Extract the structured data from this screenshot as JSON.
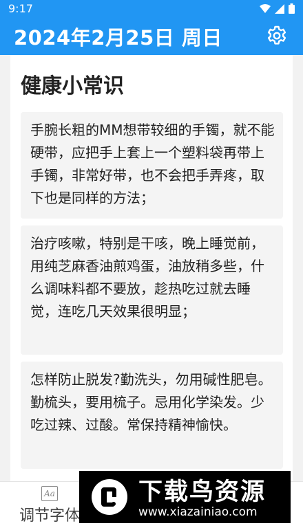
{
  "status_bar": {
    "time": "9:17",
    "icons": [
      "wifi-icon",
      "signal-icon",
      "battery-icon"
    ]
  },
  "app_bar": {
    "title": "2024年2月25日 周日",
    "settings_icon": "gear-icon"
  },
  "content": {
    "section_title": "健康小常识",
    "tips": [
      "手腕长粗的MM想带较细的手镯，就不能硬带，应把手上套上一个塑料袋再带上手镯，非常好带，也不会把手弄疼，取下也是同样的方法；",
      "治疗咳嗽，特别是干咳，晚上睡觉前，用纯芝麻香油煎鸡蛋，油放稍多些，什么调味料都不要放，趁热吃过就去睡觉，连吃几天效果很明显；",
      "怎样防止脱发?勤洗头，勿用碱性肥皂。勤梳头，要用梳子。忌用化学染发。少吃过辣、过酸。常保持精神愉快。"
    ]
  },
  "bottom_nav": {
    "font_label": "调节字体",
    "font_icon_text": "Aa"
  },
  "watermark": {
    "title": "下载鸟资源",
    "url": "www.xiazainiao.com"
  },
  "colors": {
    "primary": "#2196f3",
    "card_bg": "#f4f4f4",
    "page_bg": "#f2f2f2"
  }
}
